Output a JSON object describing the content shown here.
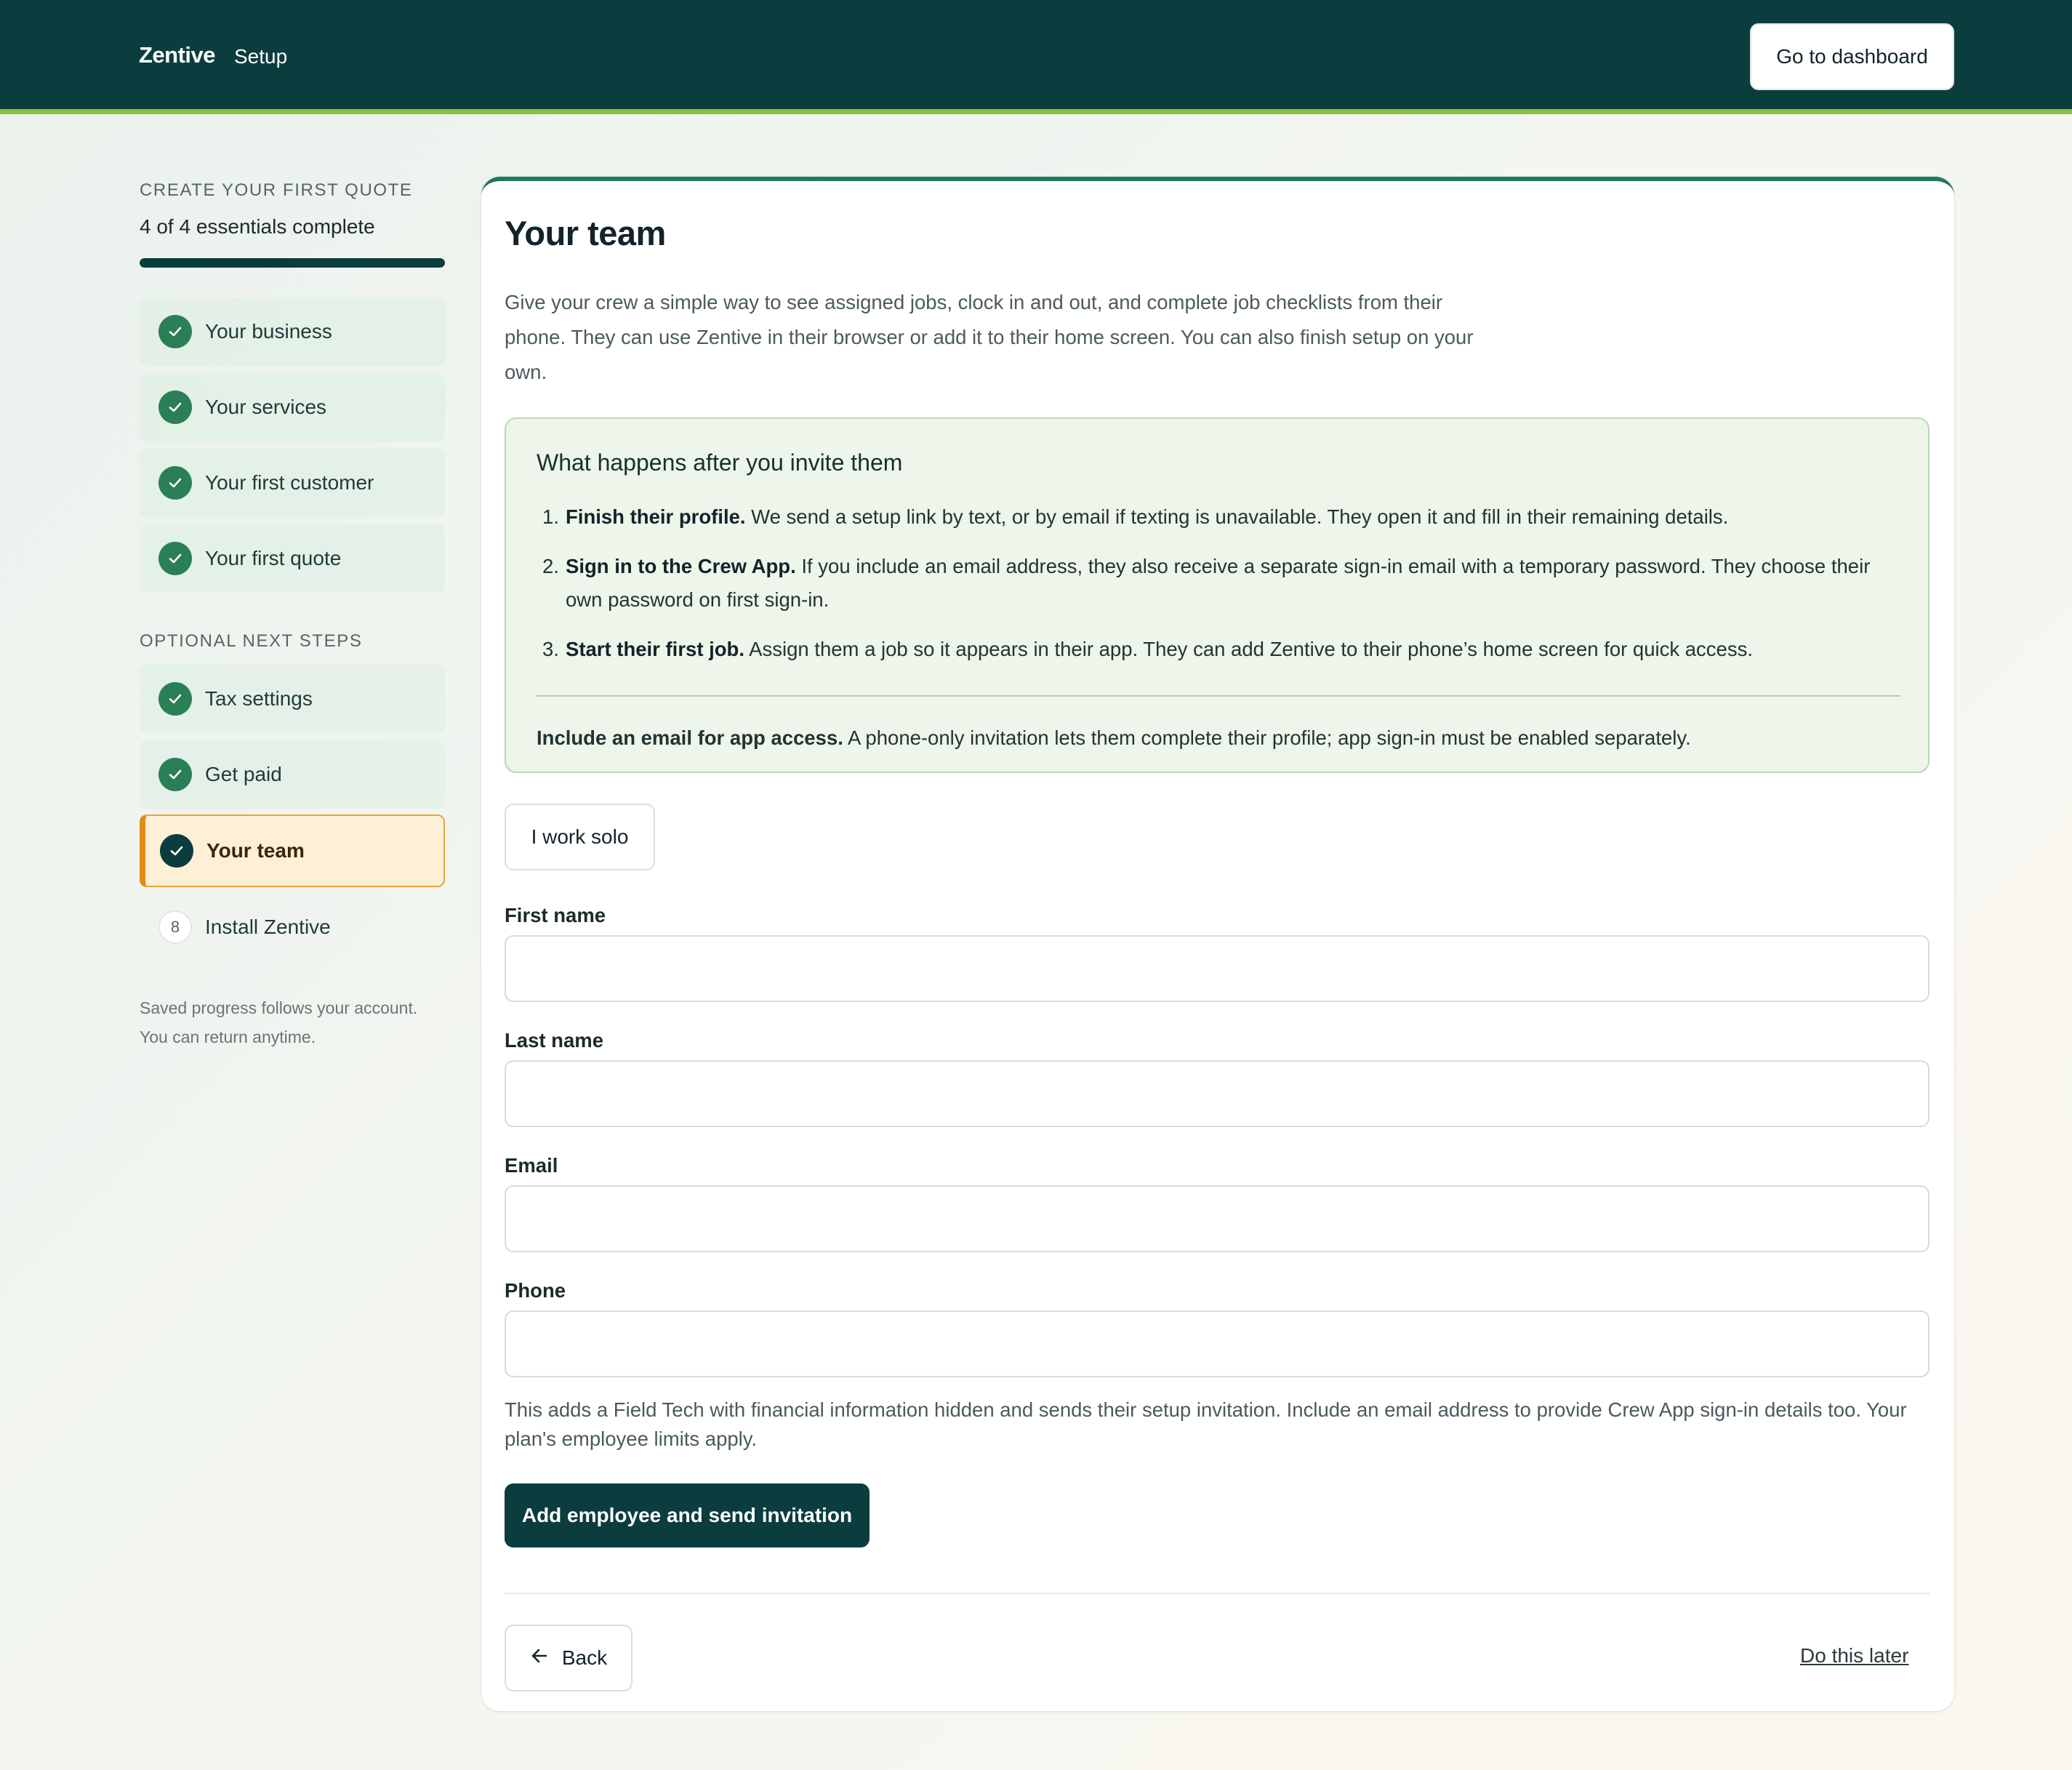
{
  "header": {
    "brand": "Zentive",
    "section": "Setup",
    "dashboard_button": "Go to dashboard"
  },
  "sidebar": {
    "heading": "CREATE YOUR FIRST QUOTE",
    "progress_text": "4 of 4 essentials complete",
    "progress_fraction": 1.0,
    "essentials": [
      {
        "label": "Your business",
        "status": "complete"
      },
      {
        "label": "Your services",
        "status": "complete"
      },
      {
        "label": "Your first customer",
        "status": "complete"
      },
      {
        "label": "Your first quote",
        "status": "complete"
      }
    ],
    "optional_heading": "OPTIONAL NEXT STEPS",
    "optional": [
      {
        "label": "Tax settings",
        "status": "complete"
      },
      {
        "label": "Get paid",
        "status": "complete"
      },
      {
        "label": "Your team",
        "status": "current"
      },
      {
        "label": "Install Zentive",
        "status": "pending",
        "number": "8"
      }
    ],
    "note_line1": "Saved progress follows your account.",
    "note_line2": "You can return anytime."
  },
  "main": {
    "title": "Your team",
    "intro": "Give your crew a simple way to see assigned jobs, clock in and out, and complete job checklists from their phone. They can use Zentive in their browser or add it to their home screen. You can also finish setup on your own.",
    "info": {
      "title": "What happens after you invite them",
      "steps": [
        {
          "num": "1.",
          "bold": "Finish their profile.",
          "text": " We send a setup link by text, or by email if texting is unavailable. They open it and fill in their remaining details."
        },
        {
          "num": "2.",
          "bold": "Sign in to the Crew App.",
          "text": " If you include an email address, they also receive a separate sign-in email with a temporary password. They choose their own password on first sign-in."
        },
        {
          "num": "3.",
          "bold": "Start their first job.",
          "text": " Assign them a job so it appears in their app. They can add Zentive to their phone’s home screen for quick access."
        }
      ],
      "note_bold": "Include an email for app access.",
      "note_text": " A phone-only invitation lets them complete their profile; app sign-in must be enabled separately."
    },
    "solo_button": "I work solo",
    "fields": {
      "first_name": {
        "label": "First name",
        "value": ""
      },
      "last_name": {
        "label": "Last name",
        "value": ""
      },
      "email": {
        "label": "Email",
        "value": ""
      },
      "phone": {
        "label": "Phone",
        "value": ""
      }
    },
    "form_note": "This adds a Field Tech with financial information hidden and sends their setup invitation. Include an email address to provide Crew App sign-in details too. Your plan's employee limits apply.",
    "submit_button": "Add employee and send invitation",
    "back_button": "Back",
    "later_link": "Do this later"
  }
}
